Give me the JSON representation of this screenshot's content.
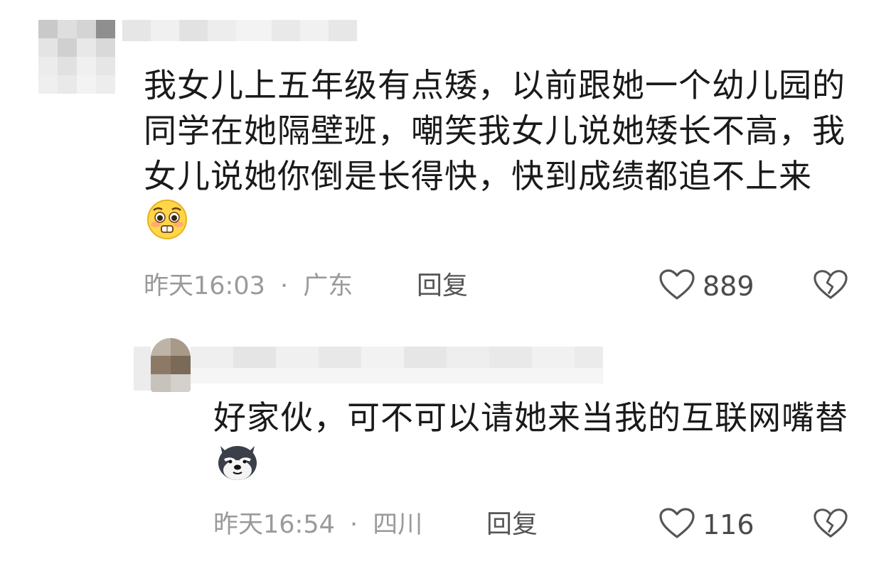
{
  "comments": [
    {
      "text": "我女儿上五年级有点矮，以前跟她一个幼儿园的同学在她隔壁班，嘲笑我女儿说她矮长不高，我女儿说她你倒是长得快，快到成绩都追不上来",
      "emoji": "pleading-face-emoji",
      "time": "昨天16:03",
      "separator": "·",
      "location": "广东",
      "reply_label": "回复",
      "likes": "889"
    },
    {
      "text": "好家伙，可不可以请她来当我的互联网嘴替",
      "emoji": "smug-dog-emoji",
      "time": "昨天16:54",
      "separator": "·",
      "location": "四川",
      "reply_label": "回复",
      "likes": "116"
    }
  ],
  "colors": {
    "text": "#1a1a1a",
    "meta": "#9a9a9a",
    "icon": "#555555"
  }
}
